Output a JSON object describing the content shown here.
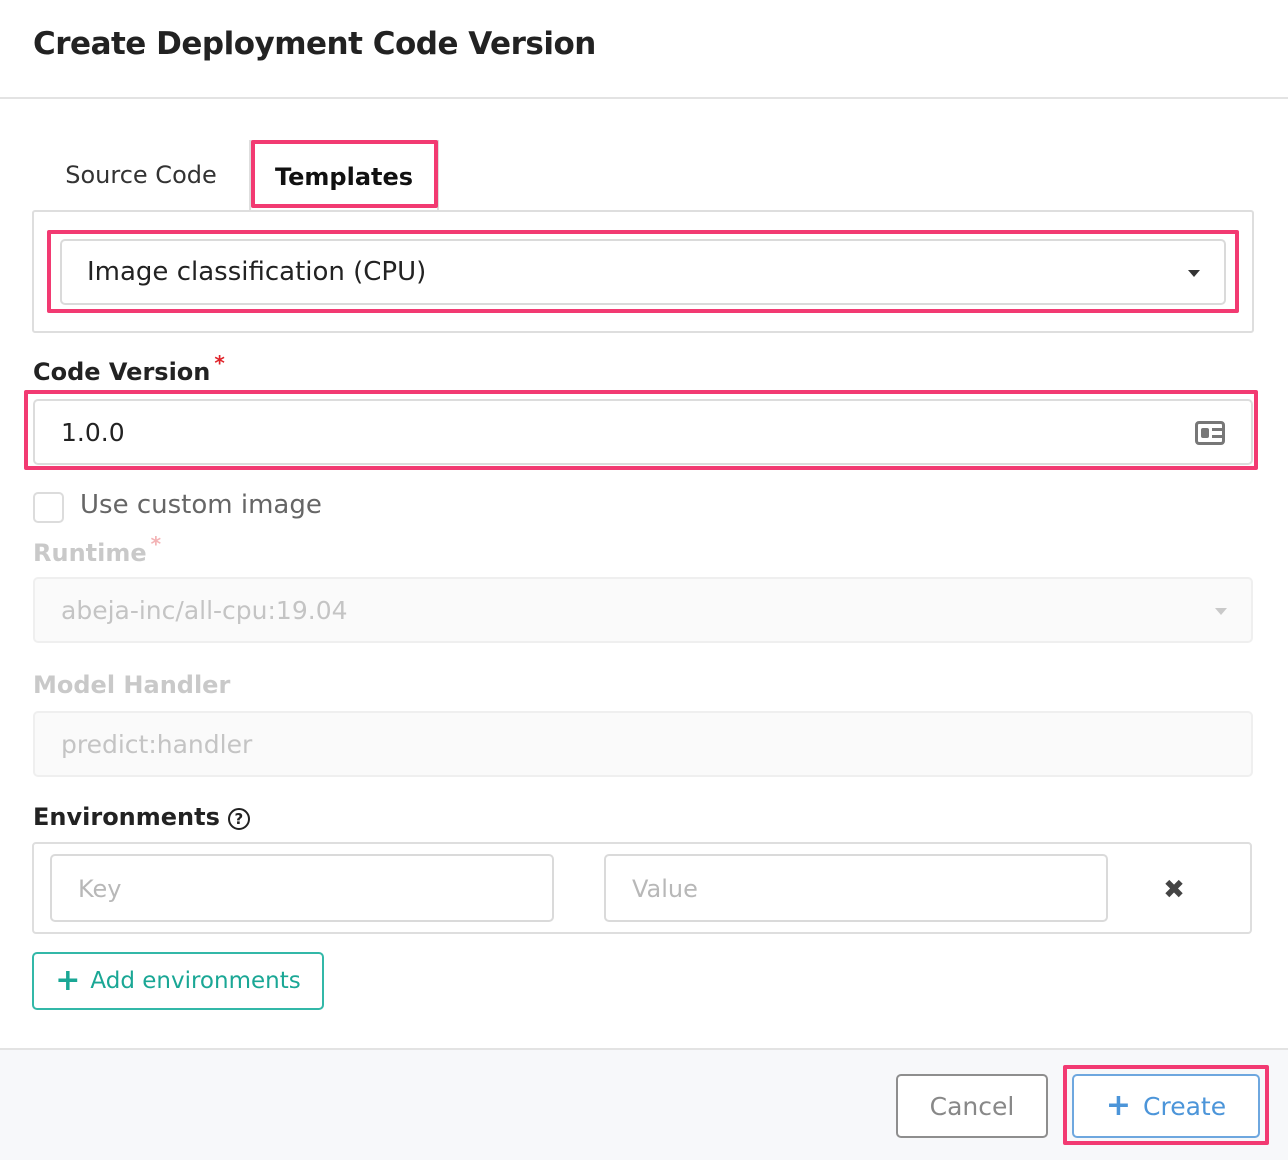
{
  "dialog": {
    "title": "Create Deployment Code Version"
  },
  "tabs": [
    {
      "label": "Source Code",
      "active": false
    },
    {
      "label": "Templates",
      "active": true
    }
  ],
  "template": {
    "selected": "Image classification (CPU)",
    "icon": "caret-down-icon"
  },
  "code_version": {
    "label": "Code Version",
    "required_mark": "*",
    "value": "1.0.0",
    "icon": "contact-card-icon"
  },
  "custom_image": {
    "label": "Use custom image",
    "checked": false
  },
  "runtime": {
    "label": "Runtime",
    "required_mark": "*",
    "value": "abeja-inc/all-cpu:19.04",
    "disabled": true
  },
  "model_handler": {
    "label": "Model Handler",
    "value": "predict:handler",
    "disabled": true
  },
  "environments": {
    "label": "Environments",
    "help_icon": "help-circle-icon",
    "key_placeholder": "Key",
    "value_placeholder": "Value",
    "remove_icon": "close-icon",
    "add_label": "Add environments"
  },
  "footer": {
    "cancel_label": "Cancel",
    "create_label": "Create"
  },
  "colors": {
    "highlight": "#f23a72",
    "accent_teal": "#1aa795",
    "accent_blue": "#4c95d9",
    "required": "#e0242a"
  }
}
